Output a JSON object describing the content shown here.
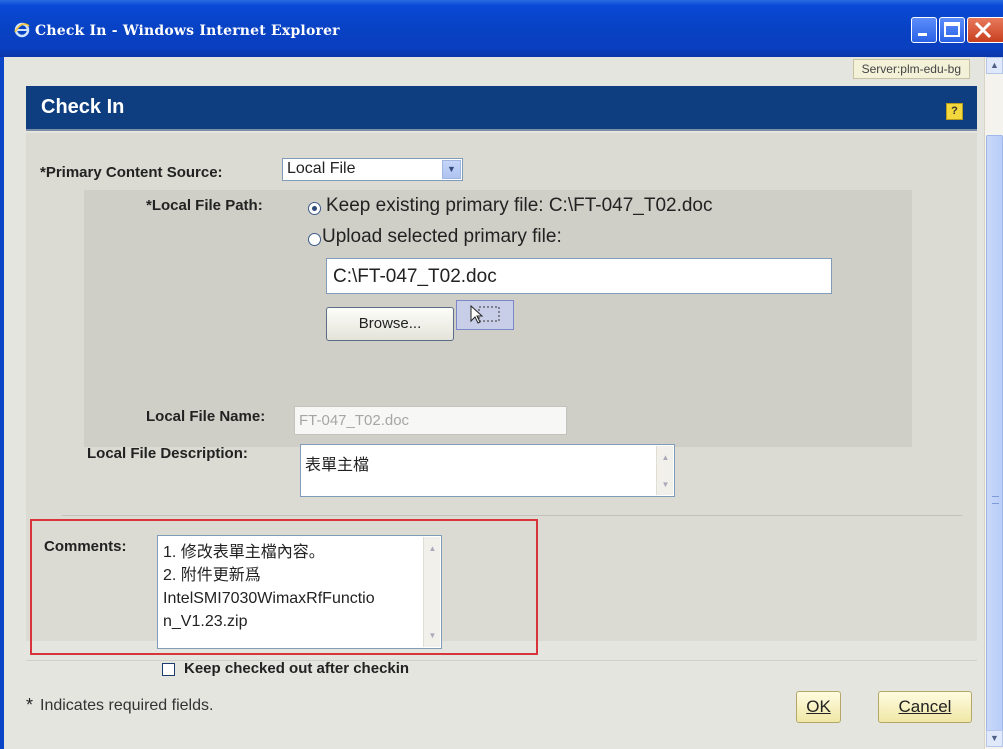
{
  "window": {
    "title": "Check In - Windows Internet Explorer"
  },
  "server_tag": "Server:plm-edu-bg",
  "dialog": {
    "title": "Check In",
    "help_label": "?"
  },
  "form": {
    "primary_content_source": {
      "label": "*Primary Content Source:",
      "selected": "Local File"
    },
    "local_file_path": {
      "label": "*Local File Path:",
      "option_keep": "Keep existing primary file: C:\\FT-047_T02.doc",
      "option_upload": "Upload selected primary file:",
      "selected_option": "keep",
      "upload_value": "C:\\FT-047_T02.doc",
      "browse_label": "Browse..."
    },
    "local_file_name": {
      "label": "Local File Name:",
      "value": "FT-047_T02.doc"
    },
    "local_file_description": {
      "label": "Local File Description:",
      "value": "表單主檔"
    },
    "comments": {
      "label": "Comments:",
      "line1": "1. 修改表單主檔內容。",
      "line2": "2. 附件更新爲",
      "line3": "IntelSMI7030WimaxRfFunctio",
      "line4": "n_V1.23.zip"
    },
    "keep_checked_out": {
      "label": "Keep checked out after checkin",
      "checked": false
    }
  },
  "footer": {
    "required_note": "Indicates required fields.",
    "asterisk": "*",
    "ok_label": "OK",
    "cancel_label": "Cancel"
  },
  "colors": {
    "titlebar": "#0a49d6",
    "dialog_header": "#0e3e80",
    "highlight_box": "#d8353a"
  }
}
